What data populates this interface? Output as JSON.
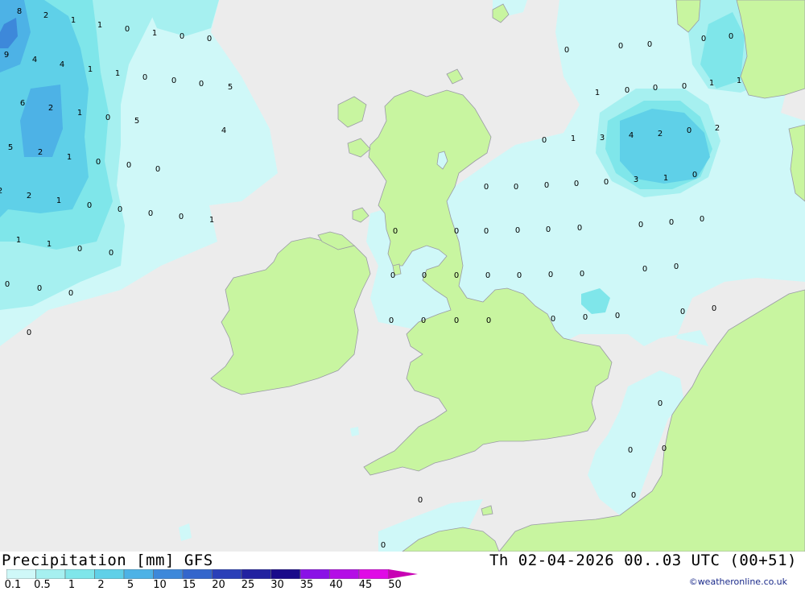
{
  "map": {
    "colors": {
      "sea": "#ececec",
      "land": "#c8f5a0",
      "coast": "#9a9aa6",
      "p01": "#cff8f8",
      "p05": "#a6f0f0",
      "p1": "#7fe6ea",
      "p2": "#5fd0e8",
      "p5": "#4db2e6",
      "p10": "#3d88da"
    },
    "values": [
      "8",
      "2",
      "1",
      "1",
      "0",
      "1",
      "0",
      "0",
      "9",
      "4",
      "4",
      "1",
      "1",
      "0",
      "0",
      "0",
      "5",
      "6",
      "2",
      "1",
      "0",
      "5",
      "5",
      "2",
      "1",
      "0",
      "0",
      "0",
      "4",
      "2",
      "2",
      "1",
      "0",
      "0",
      "0",
      "0",
      "1",
      "1",
      "1",
      "0",
      "0",
      "0",
      "0",
      "0",
      "0",
      "0",
      "0",
      "0",
      "0",
      "0",
      "0",
      "0",
      "1",
      "1",
      "1",
      "0",
      "0",
      "0",
      "0",
      "1",
      "3",
      "4",
      "2",
      "0",
      "2",
      "3",
      "1",
      "0",
      "0",
      "0",
      "0",
      "0",
      "0",
      "0",
      "0",
      "0",
      "0",
      "0",
      "0",
      "0",
      "0",
      "0",
      "0",
      "0",
      "0",
      "0",
      "0",
      "0",
      "0",
      "0",
      "0",
      "0",
      "0",
      "0",
      "0",
      "0",
      "0",
      "0",
      "0",
      "0",
      "0",
      "0",
      "0",
      "0",
      "0"
    ]
  },
  "footer": {
    "title": "Precipitation [mm] GFS",
    "datetime": "Th 02-04-2026 00..03 UTC (00+51)",
    "credit": "©weatheronline.co.uk"
  },
  "legend": {
    "labels": [
      "0.1",
      "0.5",
      "1",
      "2",
      "5",
      "10",
      "15",
      "20",
      "25",
      "30",
      "35",
      "40",
      "45",
      "50"
    ],
    "colors": [
      "#cff8f8",
      "#a6f0f0",
      "#7fe6ea",
      "#5fd0e8",
      "#4db2e6",
      "#3d88da",
      "#3366cc",
      "#2a3fb8",
      "#2222a0",
      "#1a0a8a",
      "#8a12e6",
      "#b40ee6",
      "#e00ae6",
      "#c800b4"
    ]
  }
}
